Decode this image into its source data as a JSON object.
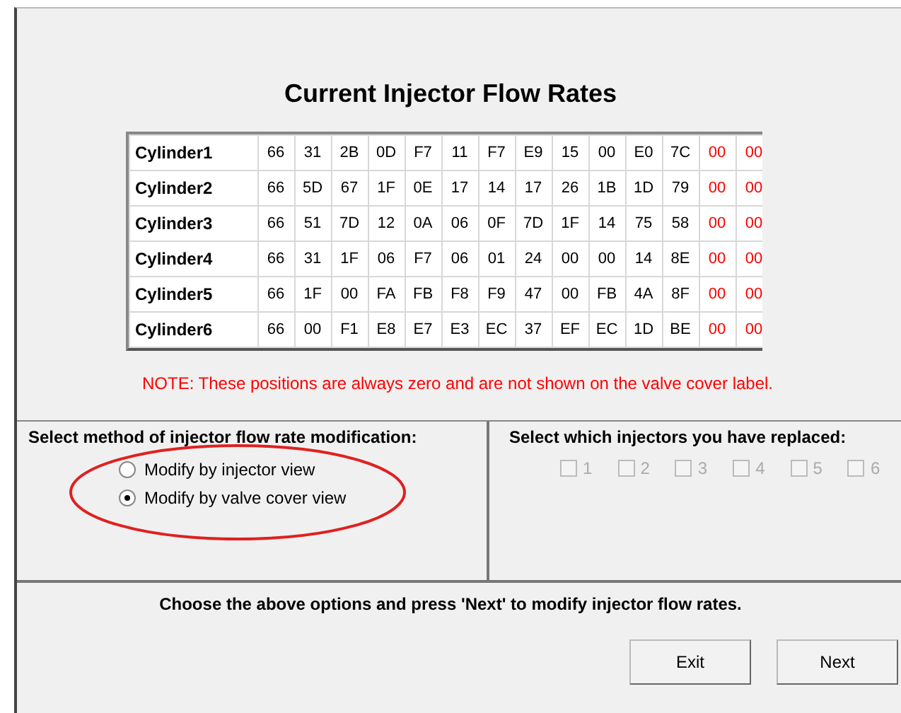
{
  "title": "Current Injector Flow Rates",
  "rows": [
    {
      "name": "Cylinder1",
      "values": [
        "66",
        "31",
        "2B",
        "0D",
        "F7",
        "11",
        "F7",
        "E9",
        "15",
        "00",
        "E0",
        "7C"
      ],
      "zeros": [
        "00",
        "00"
      ]
    },
    {
      "name": "Cylinder2",
      "values": [
        "66",
        "5D",
        "67",
        "1F",
        "0E",
        "17",
        "14",
        "17",
        "26",
        "1B",
        "1D",
        "79"
      ],
      "zeros": [
        "00",
        "00"
      ]
    },
    {
      "name": "Cylinder3",
      "values": [
        "66",
        "51",
        "7D",
        "12",
        "0A",
        "06",
        "0F",
        "7D",
        "1F",
        "14",
        "75",
        "58"
      ],
      "zeros": [
        "00",
        "00"
      ]
    },
    {
      "name": "Cylinder4",
      "values": [
        "66",
        "31",
        "1F",
        "06",
        "F7",
        "06",
        "01",
        "24",
        "00",
        "00",
        "14",
        "8E"
      ],
      "zeros": [
        "00",
        "00"
      ]
    },
    {
      "name": "Cylinder5",
      "values": [
        "66",
        "1F",
        "00",
        "FA",
        "FB",
        "F8",
        "F9",
        "47",
        "00",
        "FB",
        "4A",
        "8F"
      ],
      "zeros": [
        "00",
        "00"
      ]
    },
    {
      "name": "Cylinder6",
      "values": [
        "66",
        "00",
        "F1",
        "E8",
        "E7",
        "E3",
        "EC",
        "37",
        "EF",
        "EC",
        "1D",
        "BE"
      ],
      "zeros": [
        "00",
        "00"
      ]
    }
  ],
  "note": "NOTE: These positions are always zero and are not shown on the valve cover label.",
  "method": {
    "label": "Select method of injector flow rate modification:",
    "options": [
      {
        "label": "Modify by injector view",
        "selected": false
      },
      {
        "label": "Modify by valve cover view",
        "selected": true
      }
    ],
    "annotation": {
      "kind": "ellipse",
      "color": "#e02020"
    }
  },
  "injectors": {
    "label": "Select which injectors you have replaced:",
    "items": [
      {
        "label": "1",
        "checked": false,
        "disabled": true
      },
      {
        "label": "2",
        "checked": false,
        "disabled": true
      },
      {
        "label": "3",
        "checked": false,
        "disabled": true
      },
      {
        "label": "4",
        "checked": false,
        "disabled": true
      },
      {
        "label": "5",
        "checked": false,
        "disabled": true
      },
      {
        "label": "6",
        "checked": false,
        "disabled": true
      }
    ]
  },
  "instruction": "Choose the above options and press 'Next' to modify injector flow rates.",
  "buttons": [
    "Exit",
    "Next"
  ]
}
